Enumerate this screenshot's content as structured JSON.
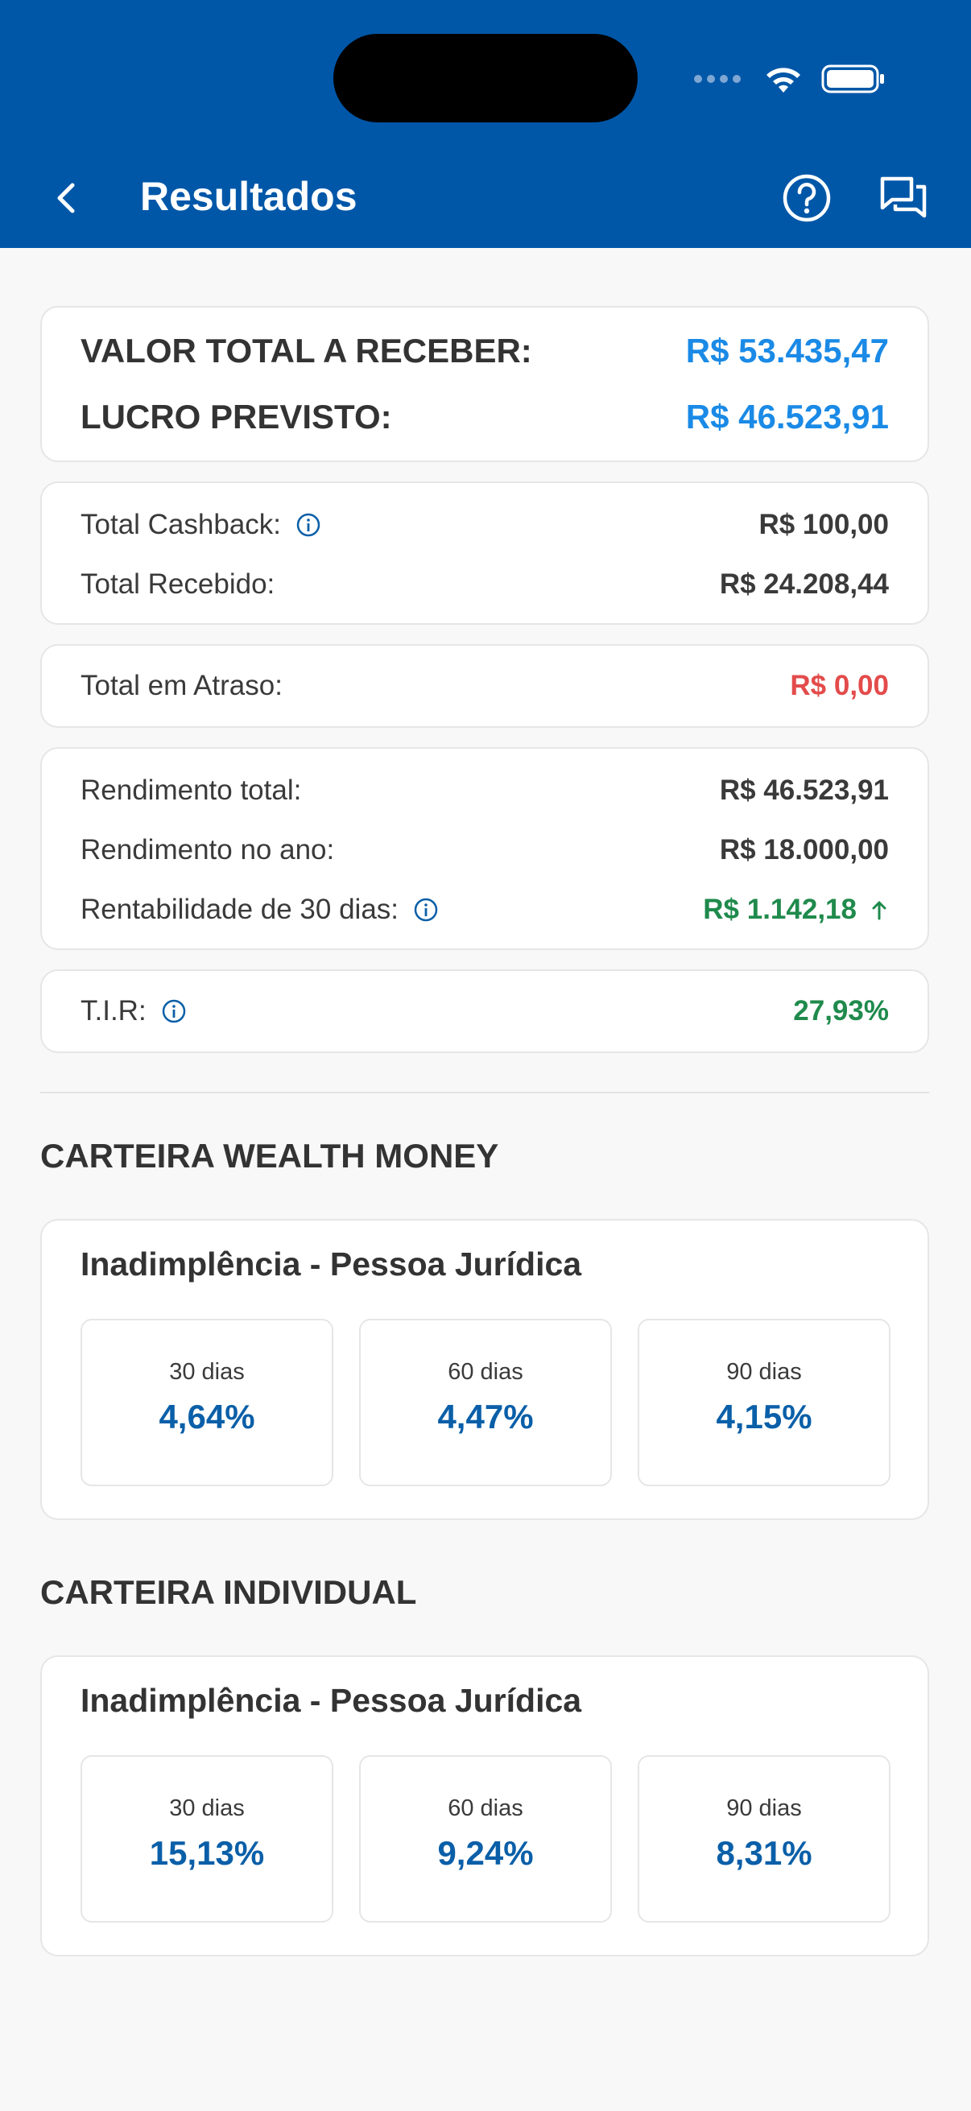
{
  "header": {
    "title": "Resultados",
    "back_icon": "chevron-left-icon",
    "help_icon": "help-circle-icon",
    "chat_icon": "chat-icon"
  },
  "summary": {
    "total_label": "VALOR TOTAL A RECEBER:",
    "total_value": "R$ 53.435,47",
    "profit_label": "LUCRO PREVISTO:",
    "profit_value": "R$ 46.523,91"
  },
  "cashback": {
    "cashback_label": "Total Cashback:",
    "cashback_value": "R$ 100,00",
    "received_label": "Total Recebido:",
    "received_value": "R$ 24.208,44"
  },
  "overdue": {
    "label": "Total em Atraso:",
    "value": "R$ 0,00"
  },
  "returns": {
    "total_label": "Rendimento total:",
    "total_value": "R$ 46.523,91",
    "year_label": "Rendimento no ano:",
    "year_value": "R$ 18.000,00",
    "profit30_label": "Rentabilidade de 30 dias:",
    "profit30_value": "R$ 1.142,18"
  },
  "tir": {
    "label": "T.I.R:",
    "value": "27,93%"
  },
  "wealth": {
    "section_title": "CARTEIRA WEALTH MONEY",
    "card_title": "Inadimplência - Pessoa Jurídica",
    "stats": [
      {
        "period": "30 dias",
        "value": "4,64%"
      },
      {
        "period": "60 dias",
        "value": "4,47%"
      },
      {
        "period": "90 dias",
        "value": "4,15%"
      }
    ]
  },
  "individual": {
    "section_title": "CARTEIRA INDIVIDUAL",
    "card_title": "Inadimplência - Pessoa Jurídica",
    "stats": [
      {
        "period": "30 dias",
        "value": "15,13%"
      },
      {
        "period": "60 dias",
        "value": "9,24%"
      },
      {
        "period": "90 dias",
        "value": "8,31%"
      }
    ]
  },
  "colors": {
    "header_bg": "#0057a8",
    "accent_blue": "#1a8ae6",
    "positive_green": "#1f8a4c",
    "negative_red": "#e34b4b",
    "stat_blue": "#0a5fa8"
  }
}
